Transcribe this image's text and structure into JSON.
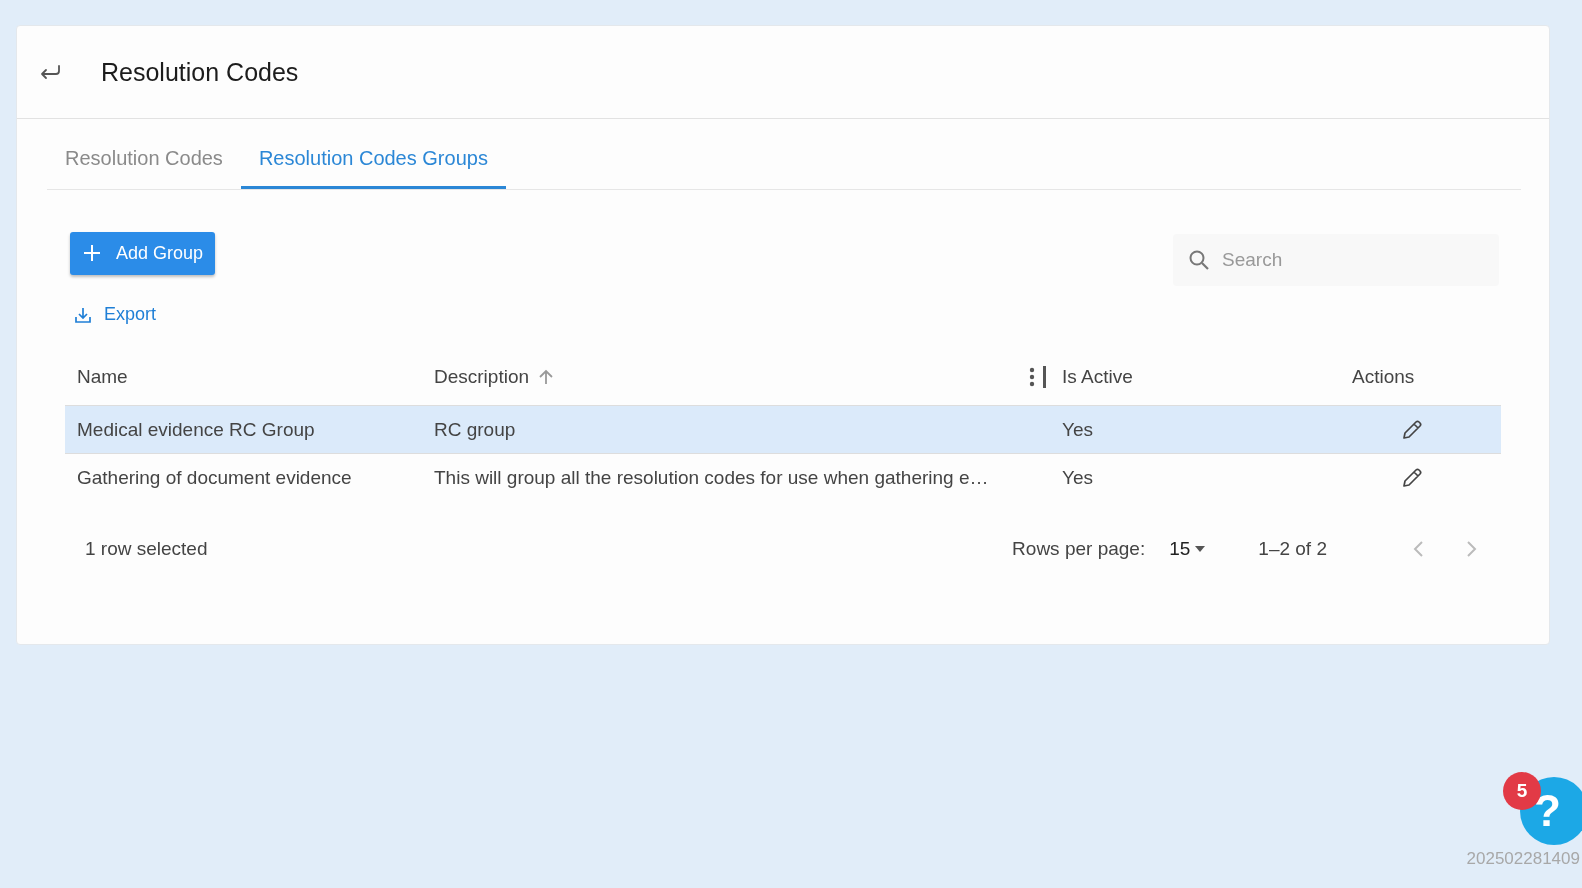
{
  "header": {
    "title": "Resolution Codes"
  },
  "tabs": [
    {
      "label": "Resolution Codes",
      "selected": false
    },
    {
      "label": "Resolution Codes Groups",
      "selected": true
    }
  ],
  "toolbar": {
    "add_button": "Add Group",
    "export_button": "Export",
    "search": {
      "placeholder": "Search"
    }
  },
  "table": {
    "columns": [
      {
        "label": "Name",
        "sorted": false,
        "menu": false
      },
      {
        "label": "Description",
        "sorted": true,
        "menu": true
      },
      {
        "label": "Is Active",
        "sorted": false,
        "menu": false
      },
      {
        "label": "Actions",
        "sorted": false,
        "menu": false
      }
    ],
    "rows": [
      {
        "name": "Medical evidence RC Group",
        "description": "RC group",
        "is_active": "Yes",
        "selected": true
      },
      {
        "name": "Gathering of document evidence",
        "description": "This will group all the resolution codes for use when gathering e…",
        "is_active": "Yes",
        "selected": false
      }
    ]
  },
  "footer": {
    "selection": "1 row selected",
    "rows_per_page_label": "Rows per page:",
    "rows_per_page": "15",
    "range": "1–2 of 2"
  },
  "help": {
    "badge": "5",
    "icon": "?"
  },
  "version": "202502281409"
}
